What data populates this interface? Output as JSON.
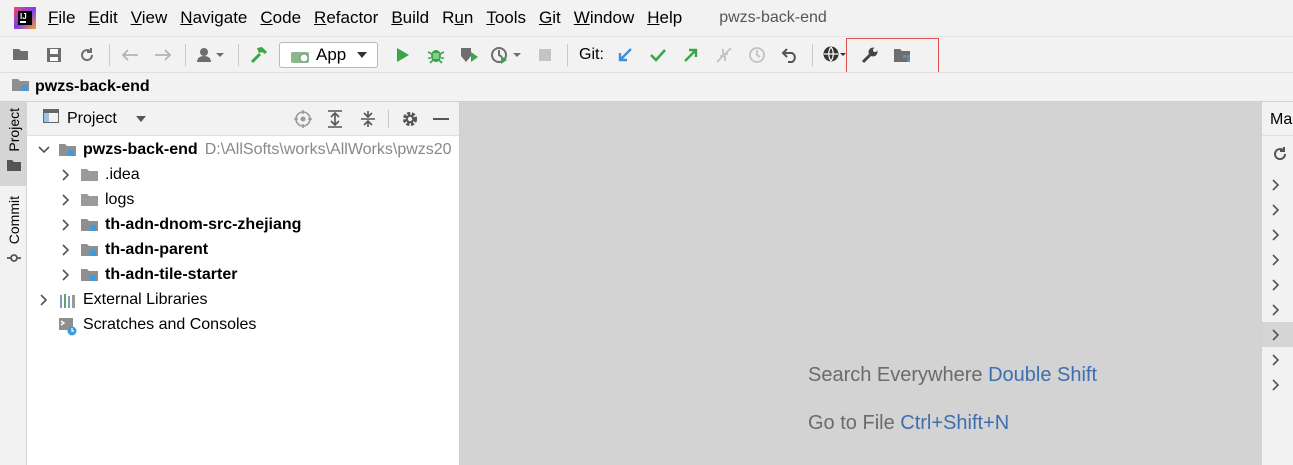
{
  "menubar": {
    "items": [
      {
        "label": "File",
        "mnemonic": "F"
      },
      {
        "label": "Edit",
        "mnemonic": "E"
      },
      {
        "label": "View",
        "mnemonic": "V"
      },
      {
        "label": "Navigate",
        "mnemonic": "N"
      },
      {
        "label": "Code",
        "mnemonic": "C"
      },
      {
        "label": "Refactor",
        "mnemonic": "R"
      },
      {
        "label": "Build",
        "mnemonic": "B"
      },
      {
        "label": "Run",
        "mnemonic": "u"
      },
      {
        "label": "Tools",
        "mnemonic": "T"
      },
      {
        "label": "Git",
        "mnemonic": "G"
      },
      {
        "label": "Window",
        "mnemonic": "W"
      },
      {
        "label": "Help",
        "mnemonic": "H"
      }
    ],
    "window_title": "pwzs-back-end"
  },
  "toolbar": {
    "run_config": "App",
    "git_label": "Git:"
  },
  "breadcrumb": {
    "project": "pwzs-back-end"
  },
  "left_strip": {
    "project_tab": "Project",
    "commit_tab": "Commit"
  },
  "project_panel": {
    "title": "Project",
    "root": {
      "name": "pwzs-back-end",
      "path": "D:\\AllSofts\\works\\AllWorks\\pwzs20"
    },
    "children": [
      {
        "name": ".idea",
        "bold": false,
        "module": false
      },
      {
        "name": "logs",
        "bold": false,
        "module": false
      },
      {
        "name": "th-adn-dnom-src-zhejiang",
        "bold": true,
        "module": true
      },
      {
        "name": "th-adn-parent",
        "bold": true,
        "module": true
      },
      {
        "name": "th-adn-tile-starter",
        "bold": true,
        "module": true
      }
    ],
    "external_libraries": "External Libraries",
    "scratches": "Scratches and Consoles"
  },
  "editor": {
    "hints": [
      {
        "text": "Search Everywhere",
        "key": "Double Shift"
      },
      {
        "text": "Go to File",
        "key": "Ctrl+Shift+N"
      }
    ]
  },
  "right_panel": {
    "title": "Ma"
  },
  "colors": {
    "accent_blue": "#3d6fb0",
    "run_green": "#3aa648",
    "highlight_red": "#e05050",
    "module_blue": "#3d9be0"
  }
}
